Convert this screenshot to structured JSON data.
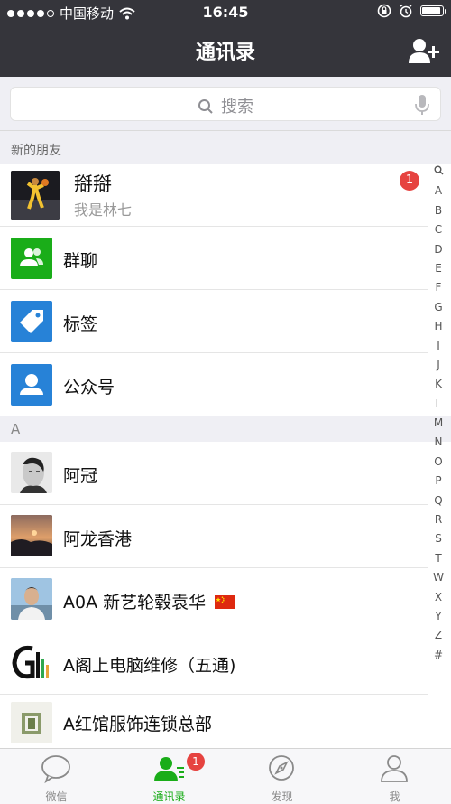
{
  "status_bar": {
    "carrier": "中国移动",
    "time": "16:45",
    "battery_level": 0.85
  },
  "nav": {
    "title": "通讯录",
    "add_icon": "add-contact-icon"
  },
  "search": {
    "placeholder": "搜索"
  },
  "new_friends": {
    "header": "新的朋友",
    "name": "搿搿",
    "message": "我是林七",
    "badge": "1"
  },
  "functions": [
    {
      "label": "群聊",
      "icon": "group-chat-icon",
      "color": "#1aad19"
    },
    {
      "label": "标签",
      "icon": "tag-icon",
      "color": "#2782d7"
    },
    {
      "label": "公众号",
      "icon": "official-account-icon",
      "color": "#2782d7"
    }
  ],
  "section_a": {
    "letter": "A",
    "contacts": [
      {
        "name": "阿冠"
      },
      {
        "name": "阿龙香港"
      },
      {
        "name": "A0A 新艺轮毂袁华"
      },
      {
        "name": "A阁上电脑维修（五通)"
      },
      {
        "name": "A红馆服饰连锁总部"
      }
    ]
  },
  "index": [
    "Q",
    "A",
    "B",
    "C",
    "D",
    "E",
    "F",
    "G",
    "H",
    "I",
    "J",
    "K",
    "L",
    "M",
    "N",
    "O",
    "P",
    "Q",
    "R",
    "S",
    "T",
    "W",
    "X",
    "Y",
    "Z",
    "#"
  ],
  "tabs": [
    {
      "label": "微信",
      "icon": "chat-bubble-icon"
    },
    {
      "label": "通讯录",
      "icon": "contacts-icon",
      "badge": "1",
      "active": true
    },
    {
      "label": "发现",
      "icon": "compass-icon"
    },
    {
      "label": "我",
      "icon": "person-icon"
    }
  ],
  "colors": {
    "nav_background": "#35353b",
    "accent": "#1aad19",
    "badge": "#e64340"
  }
}
